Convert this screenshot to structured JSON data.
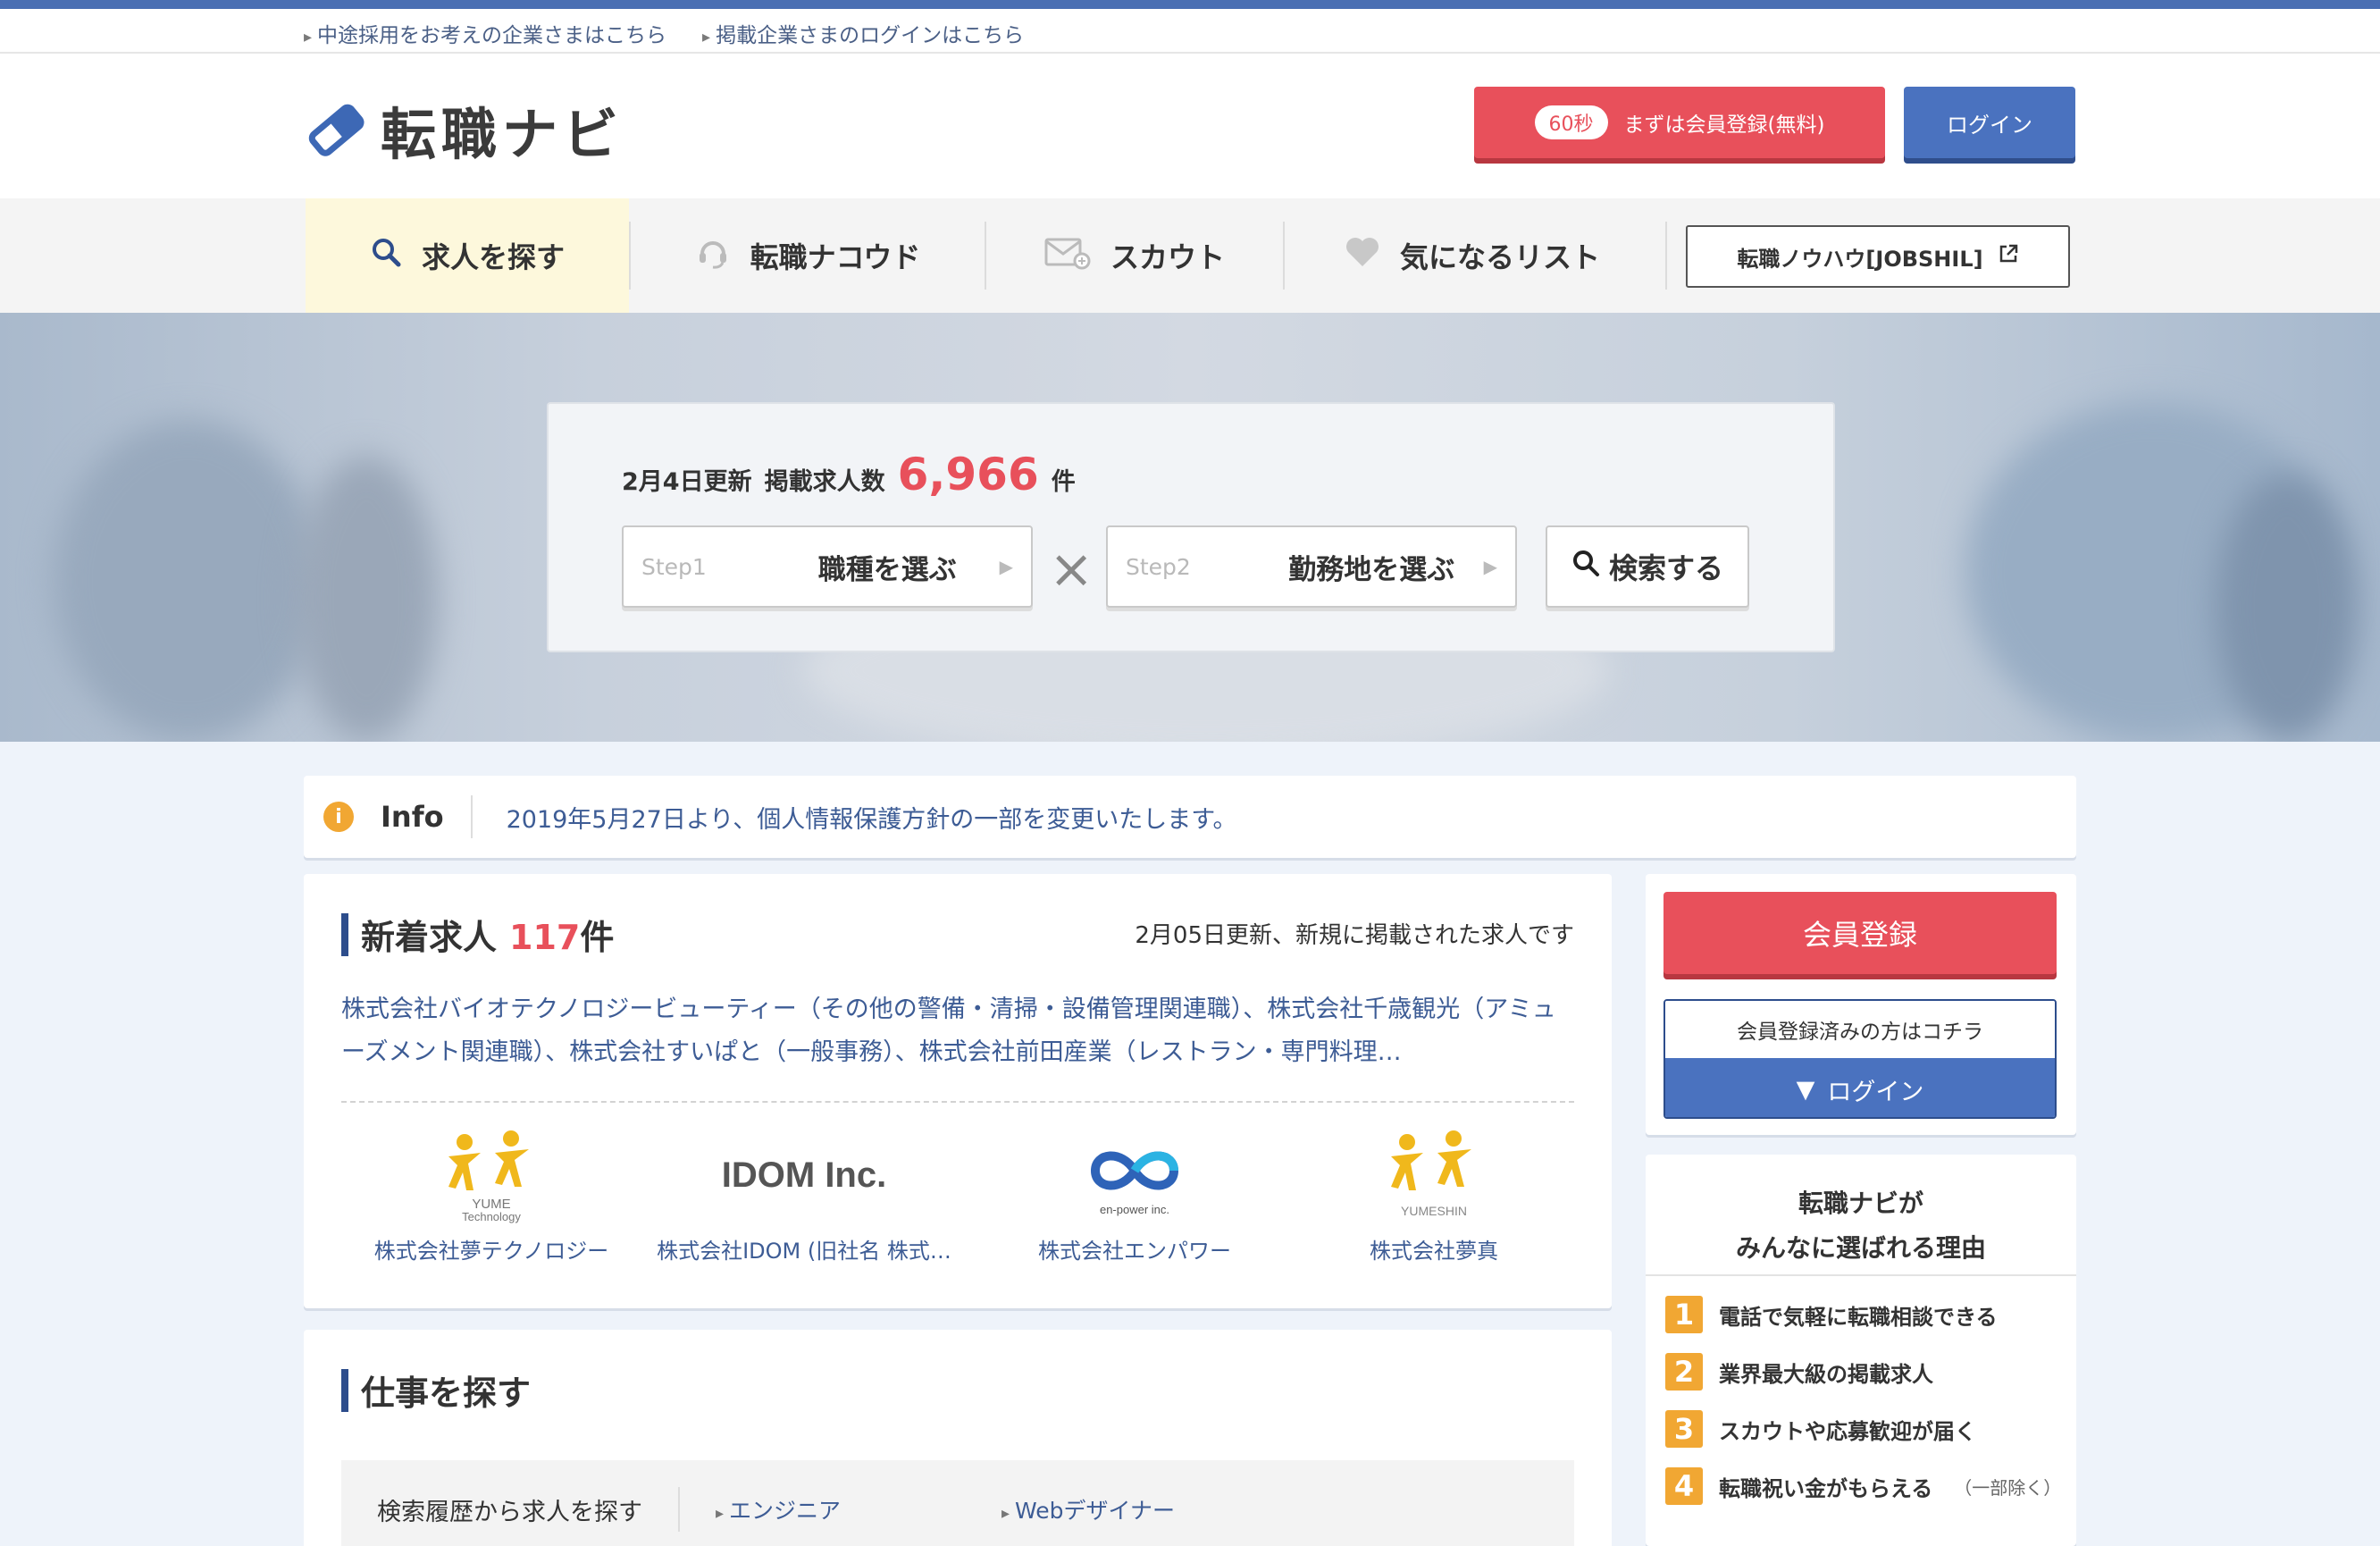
{
  "top_links": [
    "中途採用をお考えの企業さまはこちら",
    "掲載企業さまのログインはこちら"
  ],
  "header": {
    "logo_text": "転職ナビ",
    "register_badge": "60秒",
    "register_label": "まずは会員登録(無料)",
    "login_label": "ログイン"
  },
  "nav": {
    "items": [
      {
        "label": "求人を探す",
        "icon": "search-icon"
      },
      {
        "label": "転職ナコウド",
        "icon": "headset-icon"
      },
      {
        "label": "スカウト",
        "icon": "mail-icon"
      },
      {
        "label": "気になるリスト",
        "icon": "heart-icon"
      }
    ],
    "jobshil_label": "転職ノウハウ[JOBSHIL]"
  },
  "search": {
    "updated": "2月4日更新",
    "count_label": "掲載求人数",
    "count": "6,966",
    "count_unit": "件",
    "step1_tag": "Step1",
    "step1_label": "職種を選ぶ",
    "step2_tag": "Step2",
    "step2_label": "勤務地を選ぶ",
    "times": "×",
    "search_button": "検索する"
  },
  "info": {
    "icon": "i",
    "title": "Info",
    "text": "2019年5月27日より、個人情報保護方針の一部を変更いたします。"
  },
  "new_jobs": {
    "title": "新着求人",
    "count": "117",
    "count_unit": "件",
    "note": "2月05日更新、新規に掲載された求人です",
    "description": "株式会社バイオテクノロジービューティー（その他の警備・清掃・設備管理関連職）、株式会社千歳観光（アミューズメント関連職）、株式会社すいぱと（一般事務）、株式会社前田産業（レストラン・専門料理…",
    "companies": [
      {
        "name": "株式会社夢テクノロジー",
        "logo_caption": [
          "YUME",
          "Technology"
        ]
      },
      {
        "name": "株式会社IDOM (旧社名 株式…",
        "logo_caption": [
          "IDOM Inc."
        ]
      },
      {
        "name": "株式会社エンパワー",
        "logo_caption": [
          "en-power inc."
        ]
      },
      {
        "name": "株式会社夢真",
        "logo_caption": [
          "YUMESHIN"
        ]
      }
    ]
  },
  "find_jobs": {
    "title": "仕事を探す",
    "history_title": "検索履歴から求人を探す",
    "history_links": [
      "エンジニア",
      "Webデザイナー"
    ]
  },
  "member": {
    "register_label": "会員登録",
    "registered_note": "会員登録済みの方はコチラ",
    "login_label": "ログイン"
  },
  "reasons": {
    "title_line1": "転職ナビが",
    "title_line2": "みんなに選ばれる理由",
    "items": [
      {
        "num": "1",
        "text": "電話で気軽に転職相談できる",
        "sub": ""
      },
      {
        "num": "2",
        "text": "業界最大級の掲載求人",
        "sub": ""
      },
      {
        "num": "3",
        "text": "スカウトや応募歓迎が届く",
        "sub": ""
      },
      {
        "num": "4",
        "text": "転職祝い金がもらえる",
        "sub": "（一部除く）"
      }
    ]
  },
  "colors": {
    "brand_blue": "#4a72bf",
    "accent_red": "#e8505b",
    "accent_orange": "#f1a733",
    "nav_active_bg": "#fdf8dc"
  }
}
